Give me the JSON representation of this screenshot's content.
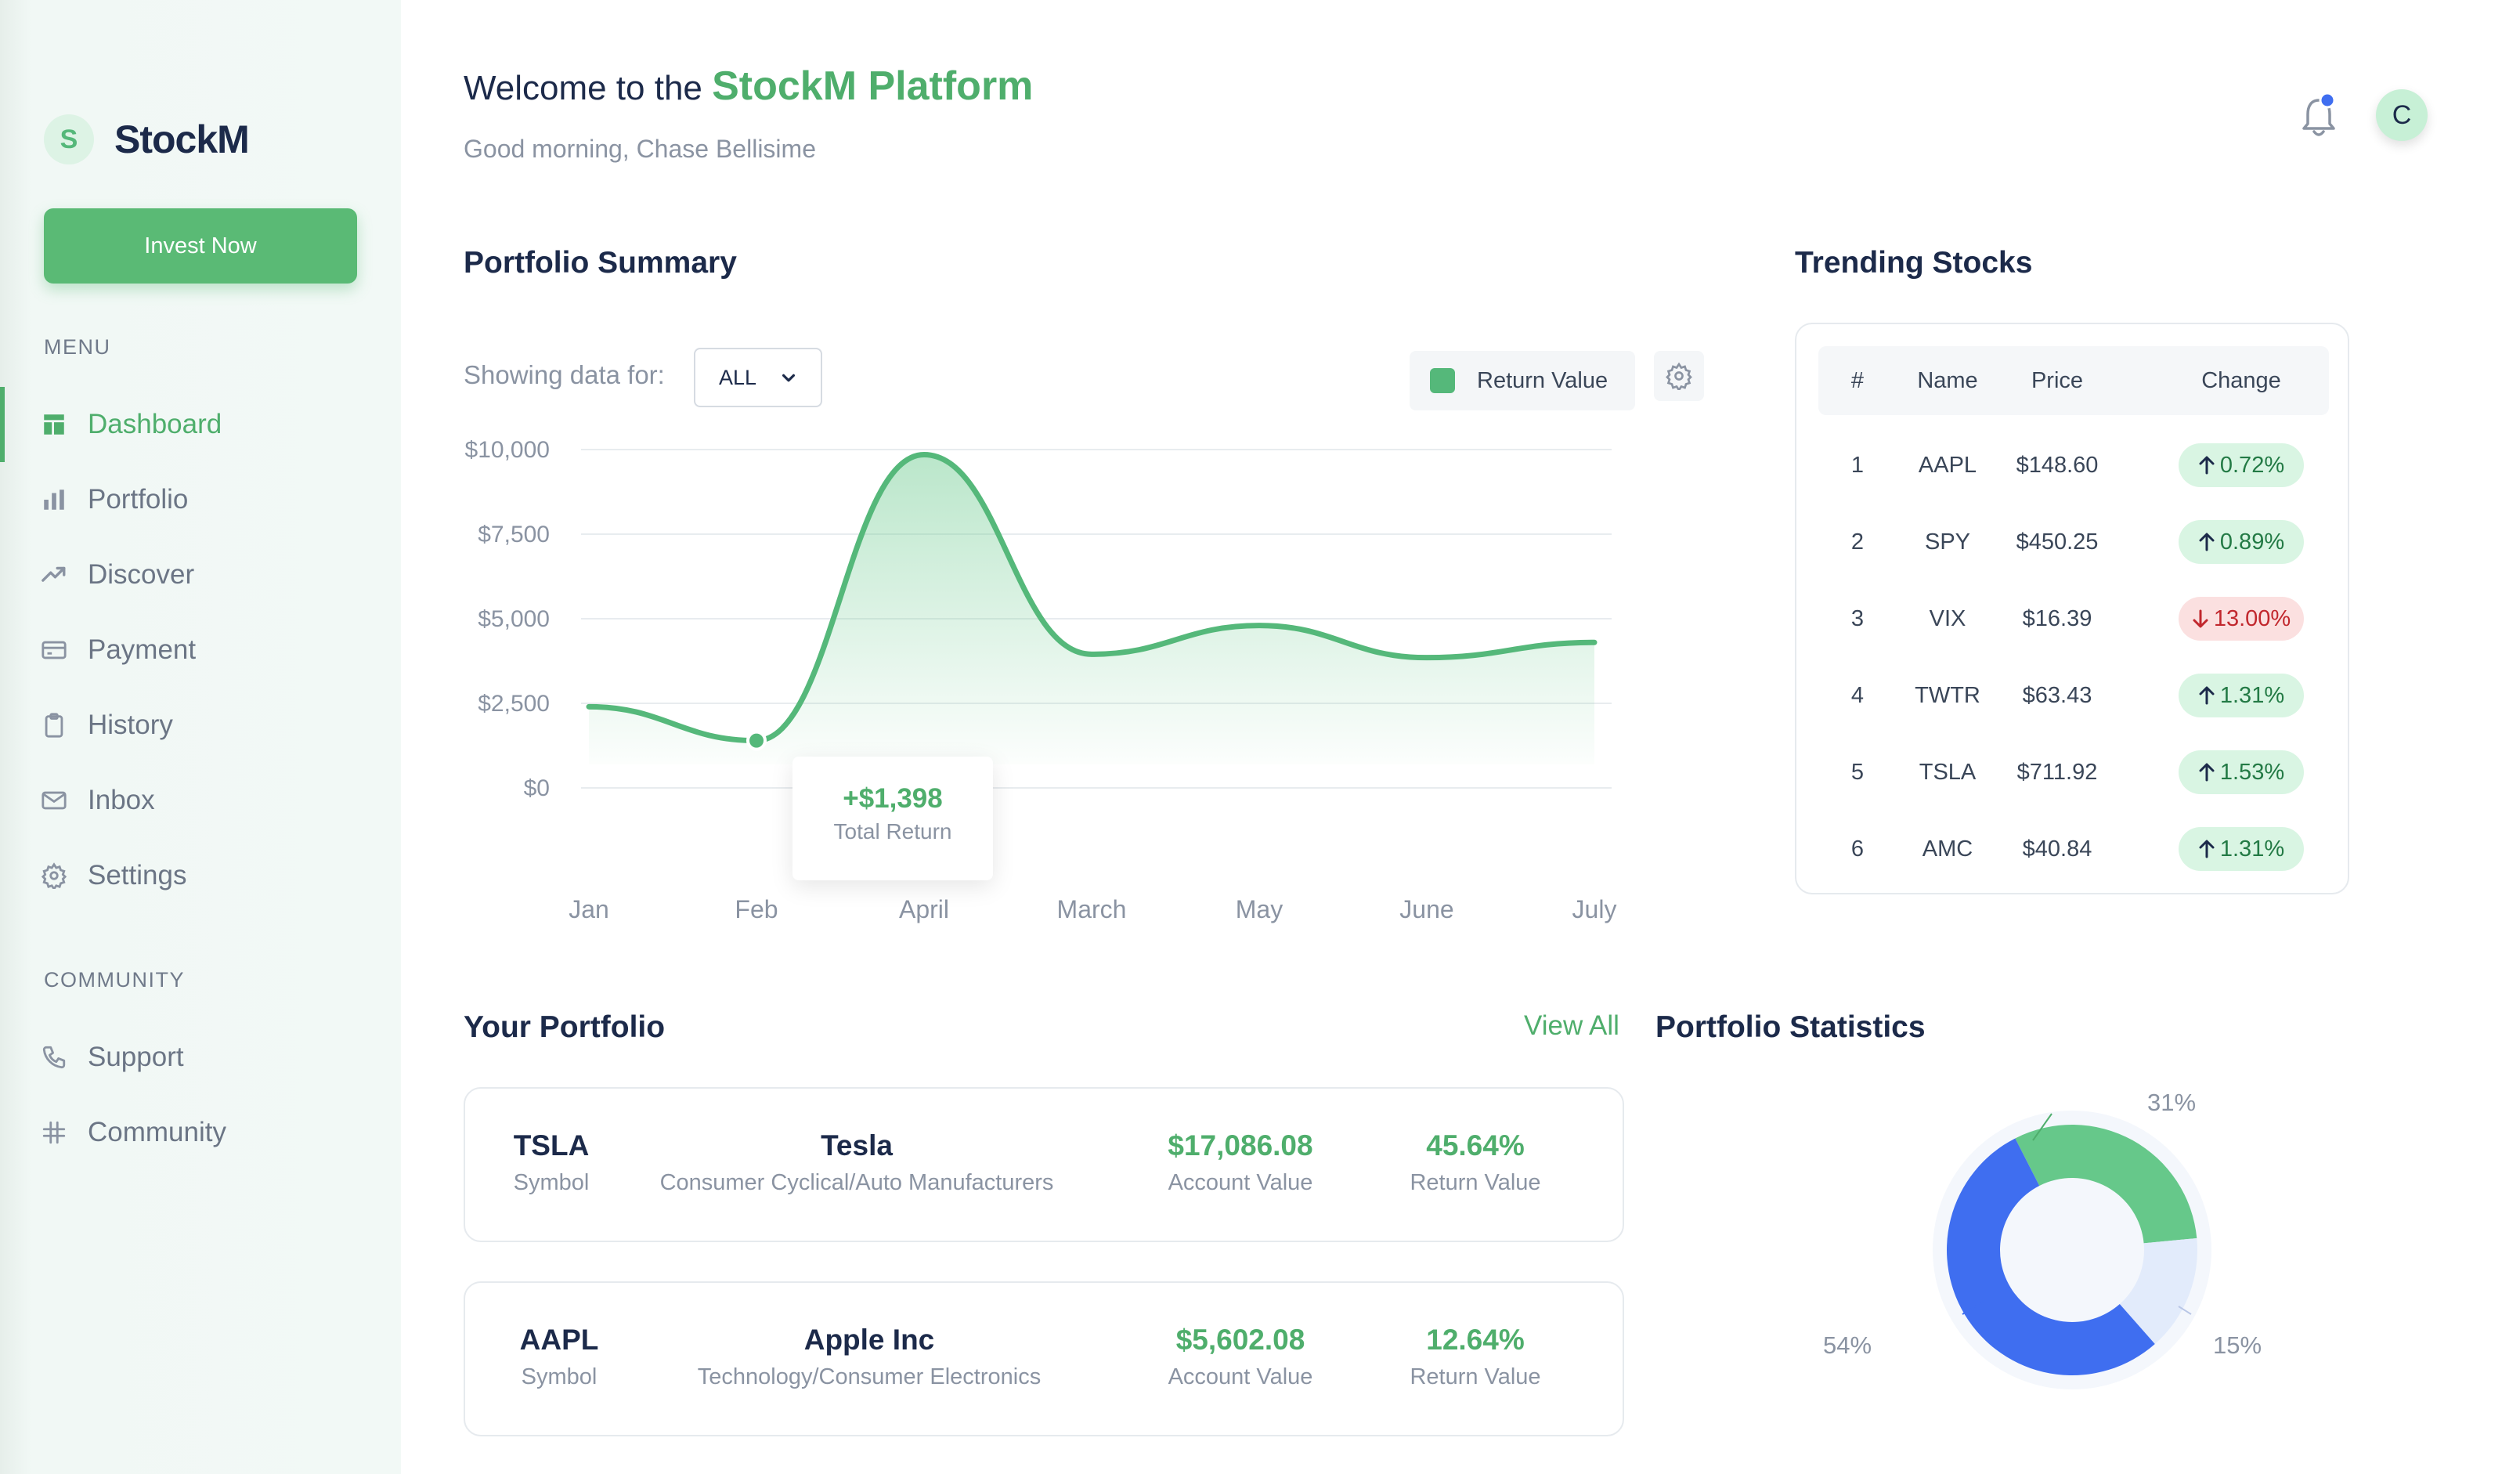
{
  "brand": {
    "logo_letter": "S",
    "name": "StockM"
  },
  "sidebar": {
    "invest_label": "Invest Now",
    "menu_heading": "MENU",
    "menu_items": [
      {
        "label": "Dashboard",
        "icon": "dashboard-icon",
        "active": true
      },
      {
        "label": "Portfolio",
        "icon": "bar-chart-icon"
      },
      {
        "label": "Discover",
        "icon": "trending-icon"
      },
      {
        "label": "Payment",
        "icon": "credit-card-icon"
      },
      {
        "label": "History",
        "icon": "clipboard-icon"
      },
      {
        "label": "Inbox",
        "icon": "mail-icon"
      },
      {
        "label": "Settings",
        "icon": "gear-icon"
      }
    ],
    "community_heading": "COMMUNITY",
    "community_items": [
      {
        "label": "Support",
        "icon": "phone-icon"
      },
      {
        "label": "Community",
        "icon": "slack-icon"
      }
    ]
  },
  "header": {
    "welcome_prefix": "Welcome to the",
    "welcome_accent": "StockM Platform",
    "greeting": "Good morning, Chase Bellisime",
    "avatar_letter": "C"
  },
  "summary": {
    "title": "Portfolio Summary",
    "filter_label": "Showing data for:",
    "filter_value": "ALL",
    "legend_label": "Return Value",
    "tooltip_value": "+$1,398",
    "tooltip_label": "Total Return"
  },
  "chart_data": {
    "type": "area",
    "categories": [
      "Jan",
      "Feb",
      "April",
      "March",
      "May",
      "June",
      "July"
    ],
    "y_tick_labels": [
      "$10,000",
      "$7,500",
      "$5,000",
      "$2,500",
      "$0"
    ],
    "ylim": [
      0,
      10000
    ],
    "series": [
      {
        "name": "Return Value",
        "values": [
          2400,
          1398,
          9850,
          3950,
          4800,
          3850,
          4300
        ]
      }
    ],
    "highlight_index": 1,
    "grid": true,
    "legend": "top-right",
    "color": "#55b87a"
  },
  "trending": {
    "title": "Trending Stocks",
    "headers": [
      "#",
      "Name",
      "Price",
      "Change"
    ],
    "rows": [
      {
        "rank": "1",
        "name": "AAPL",
        "price": "$148.60",
        "change": "0.72%",
        "dir": "up"
      },
      {
        "rank": "2",
        "name": "SPY",
        "price": "$450.25",
        "change": "0.89%",
        "dir": "up"
      },
      {
        "rank": "3",
        "name": "VIX",
        "price": "$16.39",
        "change": "13.00%",
        "dir": "down"
      },
      {
        "rank": "4",
        "name": "TWTR",
        "price": "$63.43",
        "change": "1.31%",
        "dir": "up"
      },
      {
        "rank": "5",
        "name": "TSLA",
        "price": "$711.92",
        "change": "1.53%",
        "dir": "up"
      },
      {
        "rank": "6",
        "name": "AMC",
        "price": "$40.84",
        "change": "1.31%",
        "dir": "up"
      }
    ]
  },
  "portfolio": {
    "title": "Your Portfolio",
    "view_all": "View All",
    "holdings": [
      {
        "symbol": "TSLA",
        "symbol_label": "Symbol",
        "name": "Tesla",
        "sector": "Consumer Cyclical/Auto Manufacturers",
        "value": "$17,086.08",
        "value_label": "Account Value",
        "return": "45.64%",
        "return_label": "Return Value"
      },
      {
        "symbol": "AAPL",
        "symbol_label": "Symbol",
        "name": "Apple Inc",
        "sector": "Technology/Consumer Electronics",
        "value": "$5,602.08",
        "value_label": "Account Value",
        "return": "12.64%",
        "return_label": "Return Value"
      }
    ]
  },
  "statistics": {
    "title": "Portfolio Statistics",
    "slices": [
      {
        "label": "31%",
        "value": 31,
        "color": "#66c88a"
      },
      {
        "label": "15%",
        "value": 15,
        "color": "#e2ebfb"
      },
      {
        "label": "54%",
        "value": 54,
        "color": "#3f6ef0"
      }
    ]
  }
}
